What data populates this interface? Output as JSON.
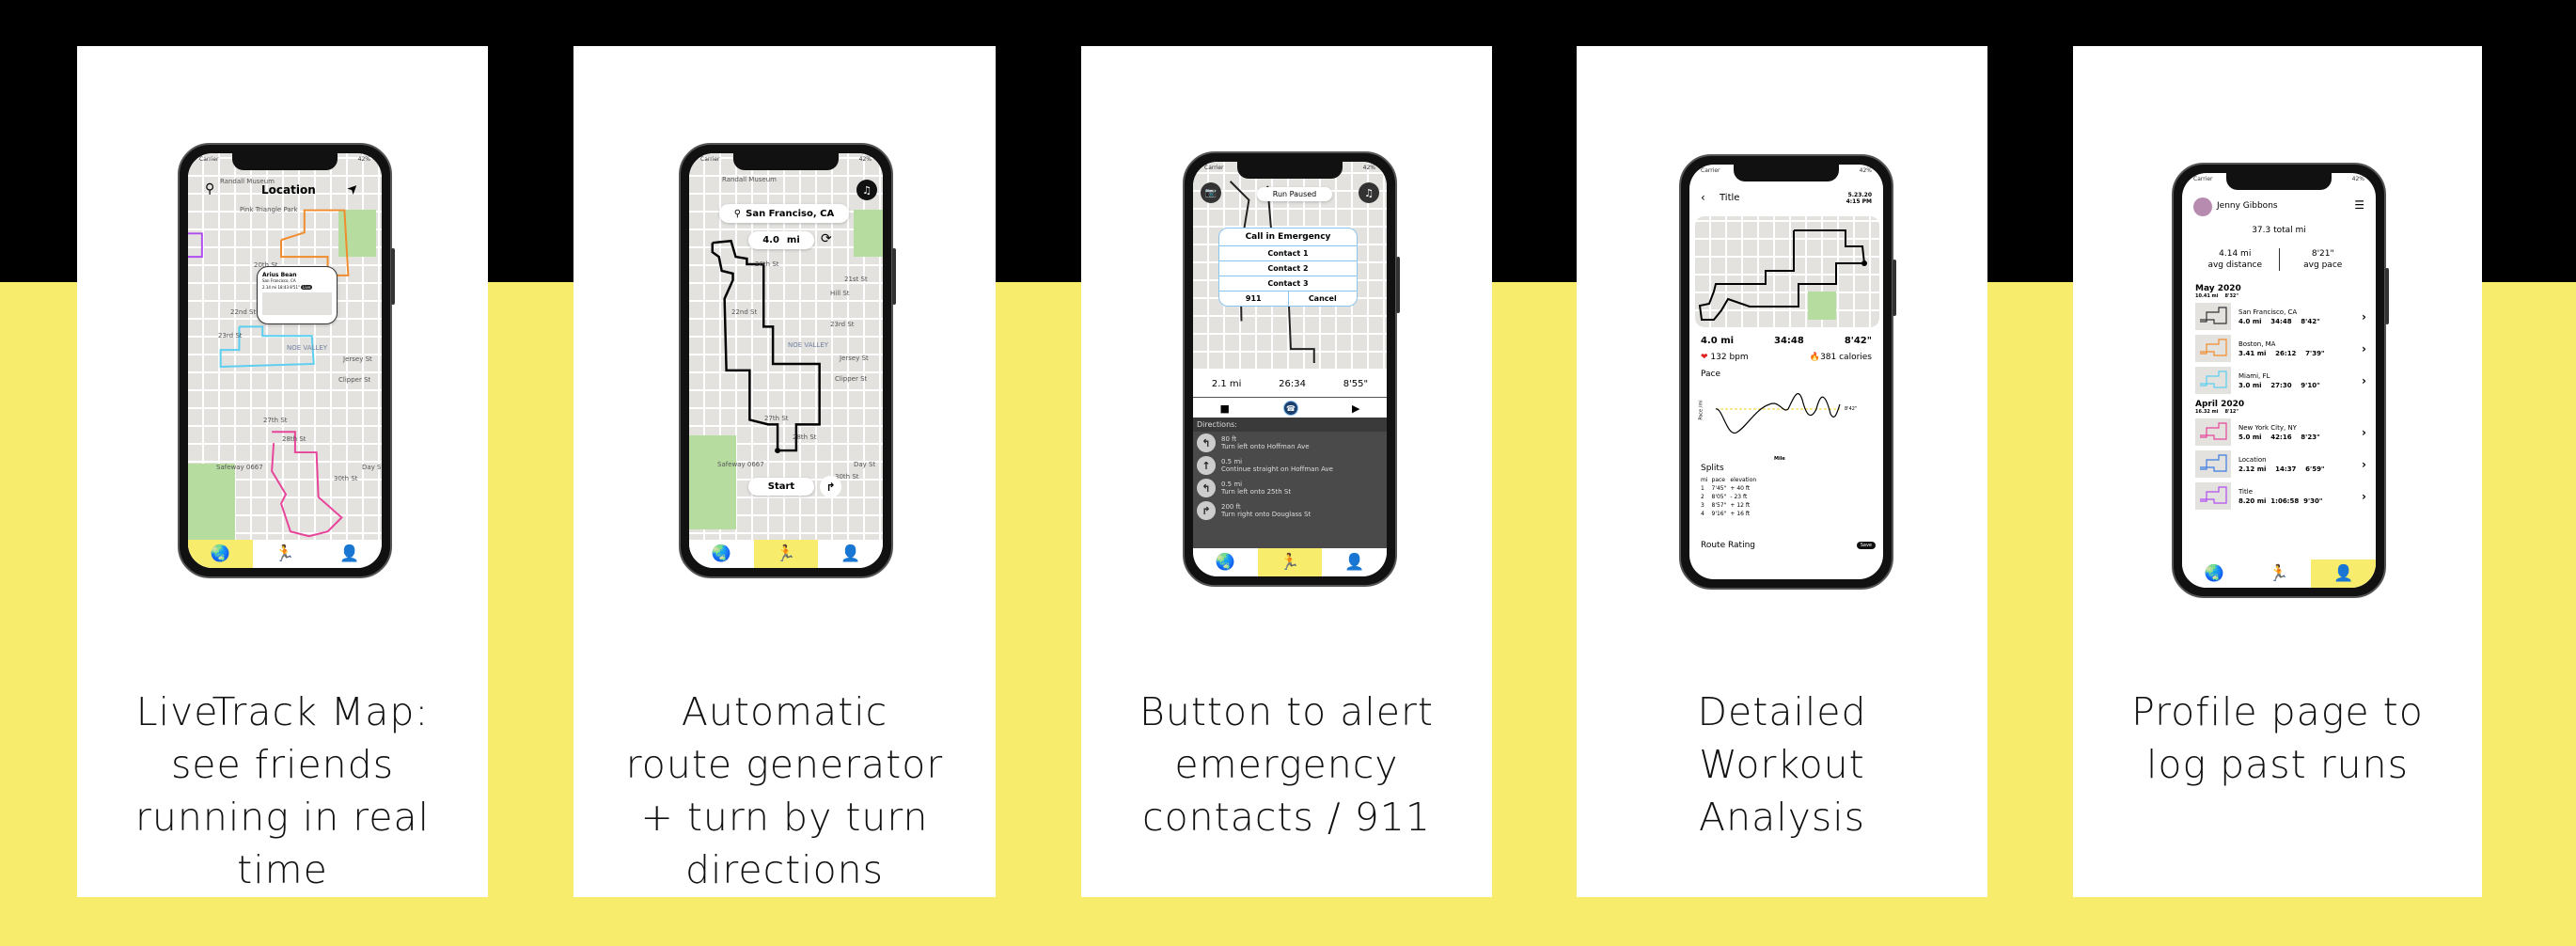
{
  "cards": [
    {
      "caption": [
        "LiveTrack Map:",
        "see friends",
        "running in real",
        "time"
      ],
      "screen": {
        "status_carrier": "Carrier",
        "status_battery": "42%",
        "title": "Location",
        "search_icon": "search-icon",
        "locate_icon": "navigation-arrow-icon",
        "map_labels": [
          "Randall Museum",
          "Pink Triangle Park",
          "20th St",
          "22nd St",
          "23rd St",
          "NOE VALLEY",
          "Jersey St",
          "Clipper St",
          "27th St",
          "28th St",
          "Safeway 0667",
          "30th St",
          "Day St"
        ],
        "friend_card": {
          "name": "Arius Bean",
          "location": "San Francisco, CA",
          "stats": "2.14 mi  18:43  8'51\"",
          "badge": "Live"
        },
        "route_colors": [
          "#f08c2c",
          "#5ccff0",
          "#e8449a",
          "#b04cf0"
        ]
      }
    },
    {
      "caption": [
        "Automatic",
        "route generator",
        "+ turn by turn",
        "directions"
      ],
      "screen": {
        "status_carrier": "Carrier",
        "status_battery": "42%",
        "search": "San Franciso, CA",
        "distance": "4.0",
        "distance_unit": "mi",
        "start_label": "Start",
        "map_labels": [
          "Randall Museum",
          "20th St",
          "21st St",
          "Hill St",
          "22nd St",
          "23rd St",
          "NOE VALLEY",
          "Jersey St",
          "Clipper St",
          "27th St",
          "28th St",
          "Safeway 0667",
          "Day St",
          "30th St"
        ]
      }
    },
    {
      "caption": [
        "Button to alert",
        "emergency",
        "contacts / 911"
      ],
      "screen": {
        "status_carrier": "Carrier",
        "status_battery": "42%",
        "banner": "Run Paused",
        "dialog": {
          "title": "Call in Emergency",
          "contacts": [
            "Contact 1",
            "Contact 2",
            "Contact 3"
          ],
          "emergency": "911",
          "cancel": "Cancel"
        },
        "stats": [
          "2.1 mi",
          "26:34",
          "8'55\""
        ],
        "directions_title": "Directions:",
        "directions": [
          {
            "icon": "turn-left-icon",
            "glyph": "↰",
            "distance": "80 ft",
            "instruction": "Turn left onto Hoffman Ave"
          },
          {
            "icon": "straight-arrow-icon",
            "glyph": "↑",
            "distance": "0.5 mi",
            "instruction": "Continue straight on Hoffman Ave"
          },
          {
            "icon": "turn-left-icon",
            "glyph": "↰",
            "distance": "0.5 mi",
            "instruction": "Turn left onto 25th St"
          },
          {
            "icon": "turn-right-icon",
            "glyph": "↱",
            "distance": "200 ft",
            "instruction": "Turn right onto Douglass St"
          }
        ]
      }
    },
    {
      "caption": [
        "Detailed",
        "Workout",
        "Analysis"
      ],
      "screen": {
        "status_carrier": "Carrier",
        "status_battery": "42%",
        "title": "Title",
        "date": "5.23.20",
        "time": "4:15 PM",
        "distance": "4.0 mi",
        "duration": "34:48",
        "pace": "8'42\"",
        "heart_rate": "132 bpm",
        "calories": "381 calories",
        "pace_title": "Pace",
        "pace_ylabel": "Pace /mi",
        "pace_xlabel": "Mile",
        "avg_pace_label": "8'42\"",
        "splits_title": "Splits",
        "splits_headers": [
          "mi",
          "pace",
          "elevation"
        ],
        "splits": [
          [
            "1",
            "7'45\"",
            "+ 40 ft"
          ],
          [
            "2",
            "8'05\"",
            "- 23 ft"
          ],
          [
            "3",
            "8'57\"",
            "+ 12 ft"
          ],
          [
            "4",
            "9'16\"",
            "+ 16 ft"
          ]
        ],
        "route_rating": "Route Rating",
        "save": "Save"
      }
    },
    {
      "caption": [
        "Profile page to",
        "log past runs"
      ],
      "screen": {
        "status_carrier": "Carrier",
        "status_battery": "42%",
        "name": "Jenny Gibbons",
        "total": "37.3 total mi",
        "avg_distance": "4.14 mi",
        "avg_distance_label": "avg distance",
        "avg_pace": "8'21\"",
        "avg_pace_label": "avg pace",
        "months": [
          {
            "title": "May 2020",
            "summary": "10.41 mi    8'32\"",
            "runs": [
              {
                "place": "San Francisco, CA",
                "stats": "4.0 mi    34:48    8'42\"",
                "color": "#333333"
              },
              {
                "place": "Boston, MA",
                "stats": "3.41 mi    26:12    7'39\"",
                "color": "#f08c2c"
              },
              {
                "place": "Miami, FL",
                "stats": "3.0 mi    27:30    9'10\"",
                "color": "#5ccff0"
              }
            ]
          },
          {
            "title": "April 2020",
            "summary": "16.32 mi    8'12\"",
            "runs": [
              {
                "place": "New York City, NY",
                "stats": "5.0 mi    42:16    8'23\"",
                "color": "#e8449a"
              },
              {
                "place": "Location",
                "stats": "2.12 mi    14:37    6'59\"",
                "color": "#3c7ce0"
              },
              {
                "place": "Title",
                "stats": "8.20 mi  1:06:58  9'30\"",
                "color": "#b04cf0"
              }
            ]
          }
        ]
      }
    }
  ],
  "tabs": {
    "map_icon": "map-pin-globe-icon",
    "run_icon": "runner-icon",
    "profile_icon": "person-icon"
  }
}
